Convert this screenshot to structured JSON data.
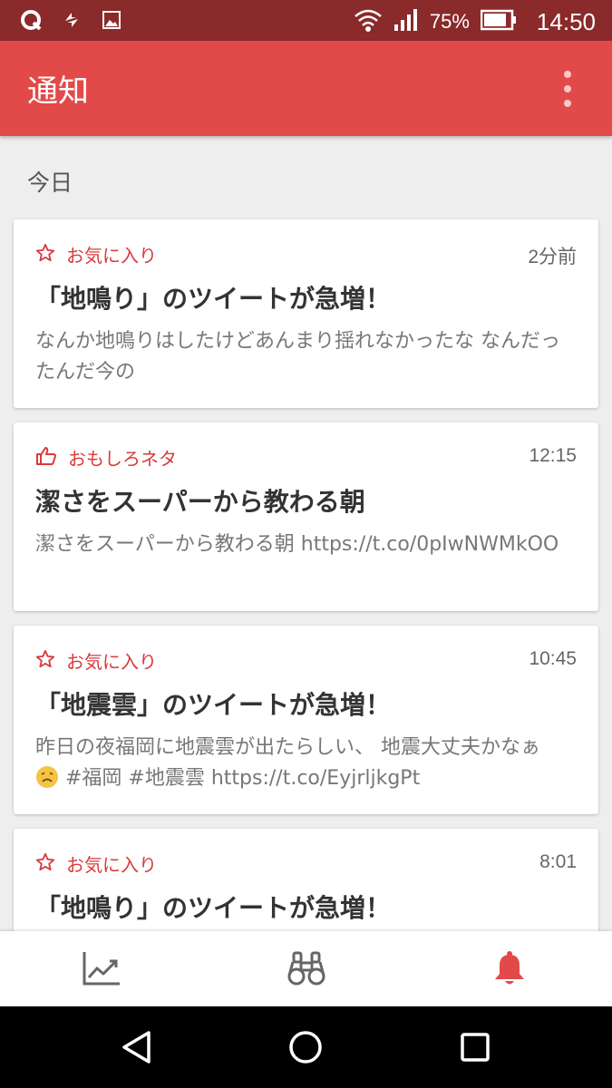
{
  "status_bar": {
    "battery_percent": "75%",
    "time": "14:50",
    "icons": [
      "q-app-icon",
      "sync-icon",
      "image-icon",
      "wifi-icon",
      "signal-icon",
      "battery-icon"
    ]
  },
  "app_bar": {
    "title": "通知",
    "menu_icon": "more-vert-icon"
  },
  "section": {
    "label": "今日"
  },
  "notifications": [
    {
      "category": "お気に入り",
      "category_icon": "star-outline-icon",
      "time": "2分前",
      "title": "「地鳴り」のツイートが急増！",
      "body": "なんか地鳴りはしたけどあんまり揺れなかったな なんだったんだ今の"
    },
    {
      "category": "おもしろネタ",
      "category_icon": "thumb-up-icon",
      "time": "12:15",
      "title": "潔さをスーパーから教わる朝",
      "body": "潔さをスーパーから教わる朝 https://t.co/0pIwNWMkOO"
    },
    {
      "category": "お気に入り",
      "category_icon": "star-outline-icon",
      "time": "10:45",
      "title": "「地震雲」のツイートが急増！",
      "body_pre": "昨日の夜福岡に地震雲が出たらしい、 地震大丈夫かなぁ",
      "body_post": " #福岡 #地震雲 https://t.co/EyjrljkgPt"
    },
    {
      "category": "お気に入り",
      "category_icon": "star-outline-icon",
      "time": "8:01",
      "title": "「地鳴り」のツイートが急増！"
    }
  ],
  "bottom_nav": {
    "items": [
      "trending-icon",
      "binoculars-icon",
      "bell-icon"
    ],
    "active": "bell-icon"
  },
  "colors": {
    "status_bar": "#8a2a2a",
    "app_bar": "#e24a49",
    "accent": "#d93a3a"
  }
}
